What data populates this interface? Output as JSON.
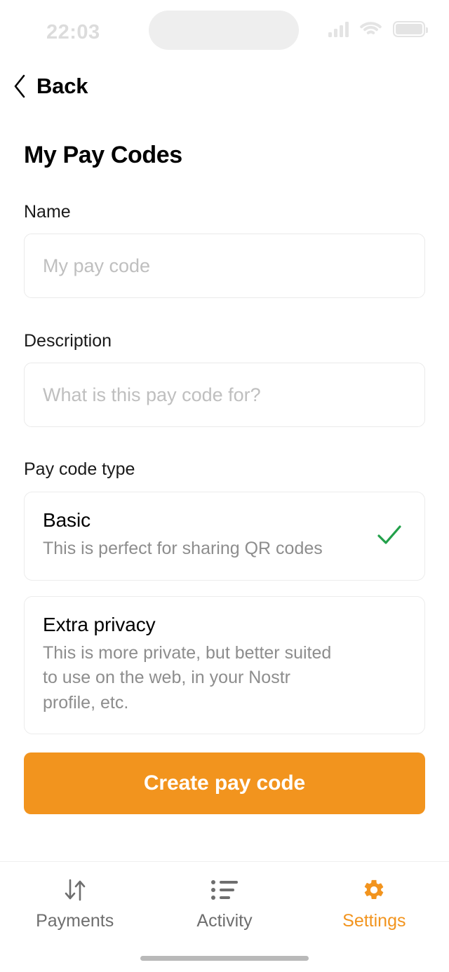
{
  "status_bar": {
    "time": "22:03",
    "signal_icon": "signal-bars-icon",
    "wifi_icon": "wifi-icon",
    "battery_icon": "battery-icon"
  },
  "nav": {
    "back_label": "Back",
    "back_icon": "chevron-left-icon"
  },
  "page": {
    "title": "My Pay Codes"
  },
  "form": {
    "name": {
      "label": "Name",
      "value": "",
      "placeholder": "My pay code"
    },
    "description": {
      "label": "Description",
      "value": "",
      "placeholder": "What is this pay code for?"
    },
    "pay_code_type": {
      "label": "Pay code type",
      "selected": "Basic",
      "options": [
        {
          "title": "Basic",
          "description": "This is perfect for sharing QR codes",
          "selected": true,
          "check_icon": "check-icon"
        },
        {
          "title": "Extra privacy",
          "description": "This is more private, but better suited to use on the web, in your Nostr profile, etc.",
          "selected": false
        }
      ]
    },
    "submit_label": "Create pay code"
  },
  "tab_bar": {
    "items": [
      {
        "label": "Payments",
        "icon": "transfer-arrows-icon",
        "active": false
      },
      {
        "label": "Activity",
        "icon": "list-icon",
        "active": false
      },
      {
        "label": "Settings",
        "icon": "gear-icon",
        "active": true
      }
    ]
  },
  "colors": {
    "accent": "#f2941e",
    "check_green": "#22a04a",
    "inactive_tab": "#6e6e6e",
    "border": "#ececec",
    "placeholder": "#bfbfbf"
  }
}
